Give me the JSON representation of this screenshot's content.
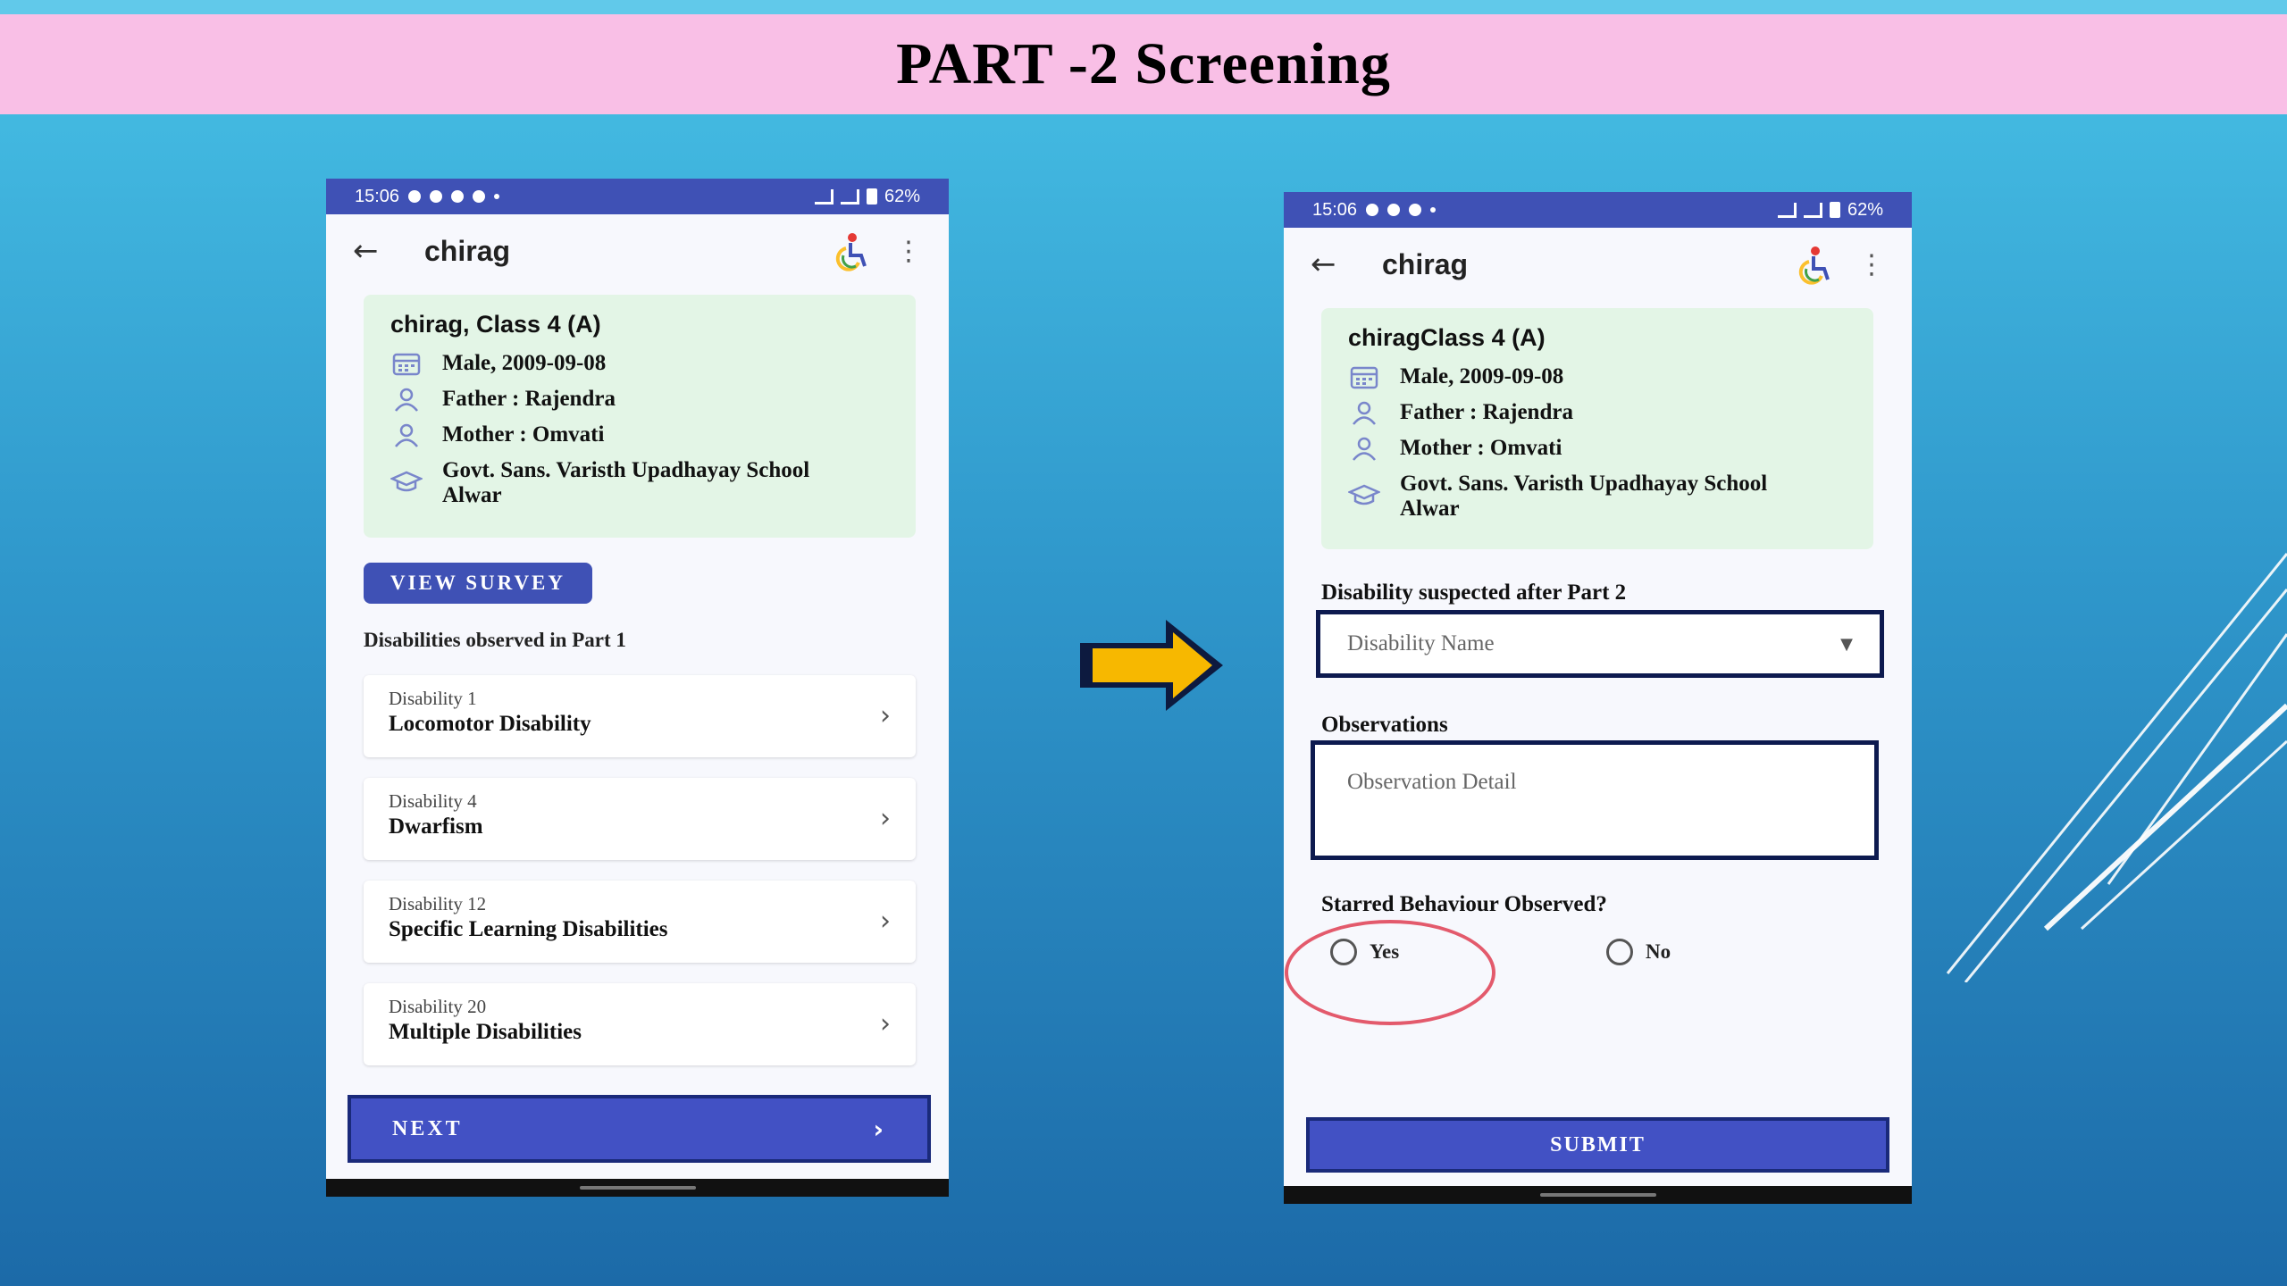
{
  "slide": {
    "title": "PART -2 Screening"
  },
  "left_phone": {
    "status": {
      "time": "15:06",
      "battery": "62%"
    },
    "appbar": {
      "back": "←",
      "title": "chirag",
      "menu": "⋮"
    },
    "profile": {
      "name": "chirag, Class 4 (A)",
      "gender_dob": "Male, 2009-09-08",
      "father": "Father : Rajendra",
      "mother": "Mother : Omvati",
      "school": "Govt.  Sans. Varisth Upadhayay School Alwar"
    },
    "view_survey": "VIEW SURVEY",
    "disabilities_label": "Disabilities observed in Part 1",
    "disabilities": [
      {
        "number": "Disability 1",
        "name": "Locomotor Disability"
      },
      {
        "number": "Disability 4",
        "name": "Dwarfism"
      },
      {
        "number": "Disability 12",
        "name": "Specific Learning Disabilities"
      },
      {
        "number": "Disability 20",
        "name": "Multiple Disabilities"
      }
    ],
    "next_label": "NEXT",
    "chevron": "›"
  },
  "right_phone": {
    "status": {
      "time": "15:06",
      "battery": "62%"
    },
    "appbar": {
      "back": "←",
      "title": "chirag",
      "menu": "⋮"
    },
    "profile": {
      "name": "chiragClass 4 (A)",
      "gender_dob": "Male, 2009-09-08",
      "father": "Father : Rajendra",
      "mother": "Mother : Omvati",
      "school": "Govt.  Sans. Varisth Upadhayay School Alwar"
    },
    "disability_label": "Disability suspected after Part 2",
    "disability_placeholder": "Disability Name",
    "dropdown_caret": "▼",
    "observations_label": "Observations",
    "observation_placeholder": "Observation Detail",
    "starred_label": "Starred Behaviour Observed?",
    "radio_yes": "Yes",
    "radio_no": "No",
    "submit_label": "SUBMIT"
  },
  "colors": {
    "banner": "#f9bfe6",
    "primary": "#3f51b5",
    "card_green": "#e3f5e6",
    "arrow_yellow": "#f7b800",
    "highlight": "#e35a6c"
  },
  "icons": [
    "calendar-icon",
    "person-icon",
    "school-icon",
    "wheelchair-icon",
    "back-arrow-icon",
    "more-vert-icon",
    "chevron-right-icon",
    "dropdown-caret-icon",
    "right-arrow-icon"
  ]
}
